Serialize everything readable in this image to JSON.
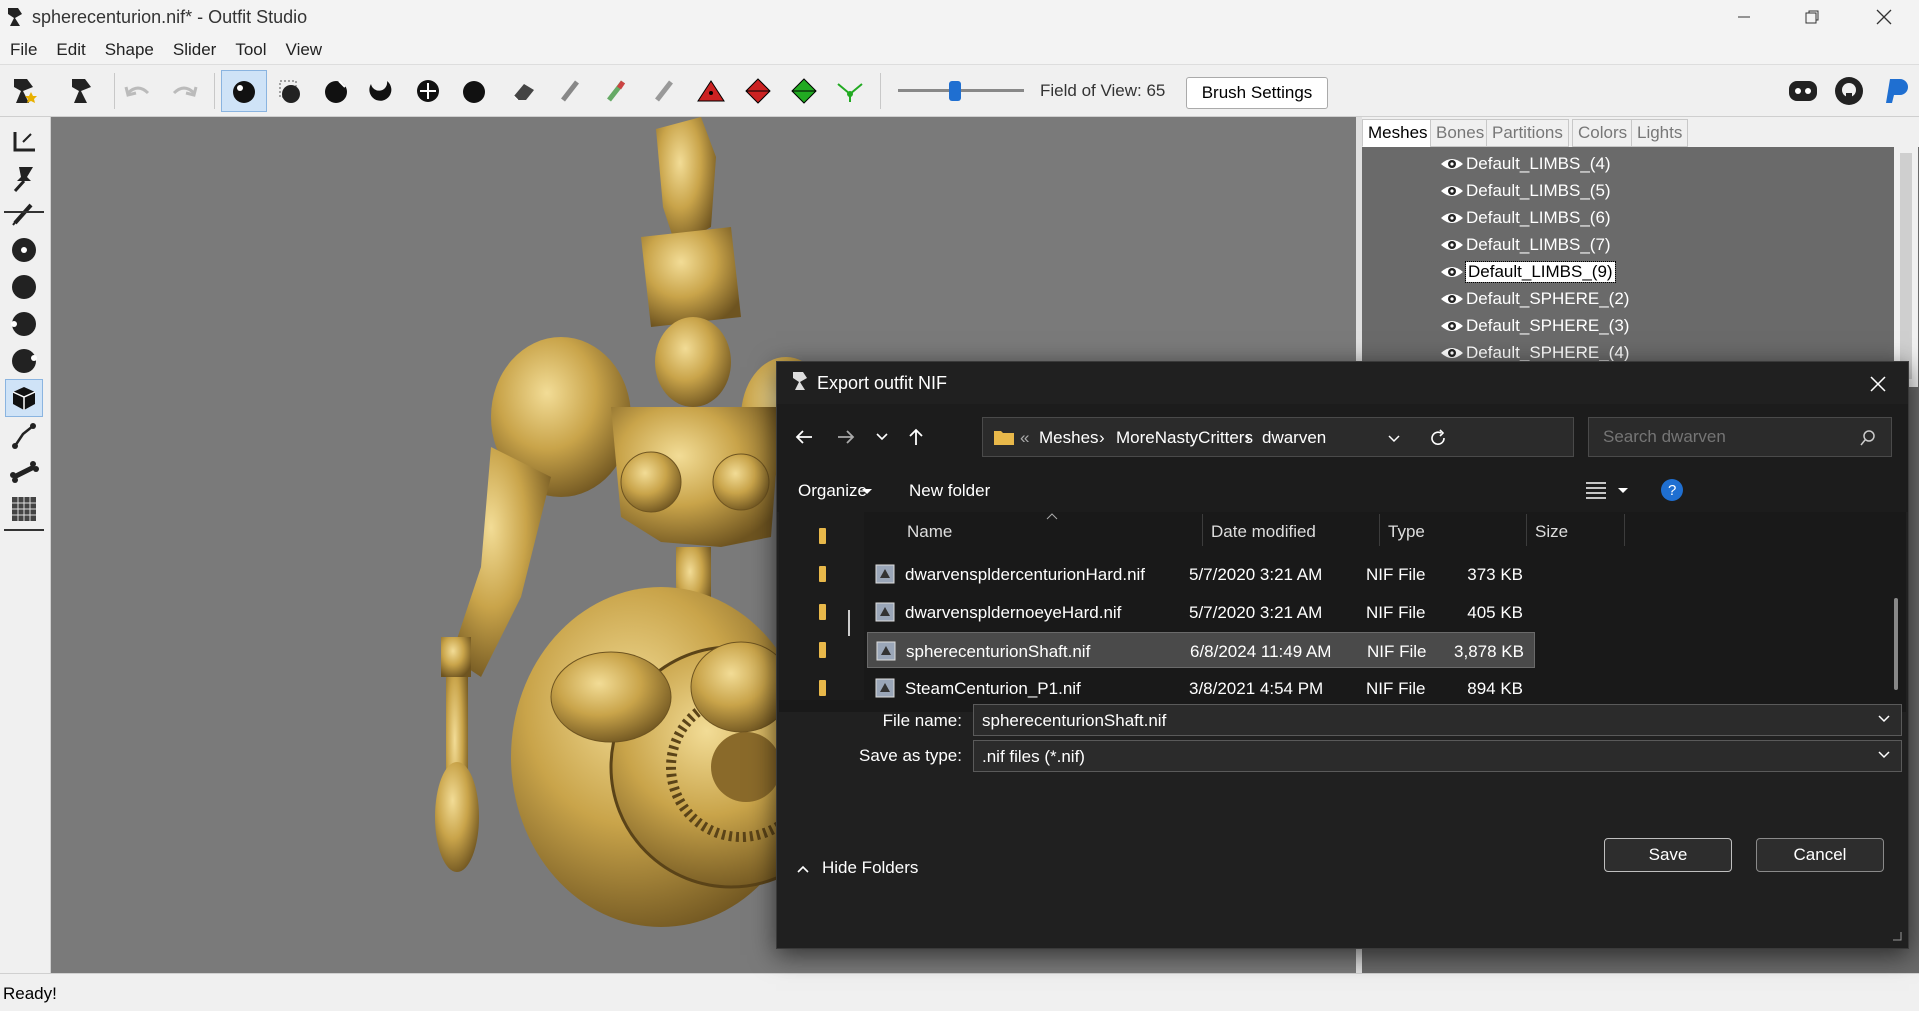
{
  "window": {
    "title": "spherecenturion.nif* - Outfit Studio"
  },
  "menu": [
    "File",
    "Edit",
    "Shape",
    "Slider",
    "Tool",
    "View"
  ],
  "toolbar": {
    "fov_label": "Field of View: 65",
    "brush_settings_label": "Brush Settings",
    "fov_slider_fraction": 0.45
  },
  "right_panel": {
    "tabs": [
      "Meshes",
      "Bones",
      "Partitions",
      "Colors",
      "Lights"
    ],
    "meshes": [
      "Default_LIMBS_(4)",
      "Default_LIMBS_(5)",
      "Default_LIMBS_(6)",
      "Default_LIMBS_(7)",
      "Default_LIMBS_(9)",
      "Default_SPHERE_(2)",
      "Default_SPHERE_(3)",
      "Default_SPHERE_(4)"
    ],
    "selected_mesh": "Default_LIMBS_(9)"
  },
  "status": {
    "text": "Ready!"
  },
  "dialog": {
    "title": "Export outfit NIF",
    "breadcrumb": {
      "overflow": "«",
      "parts": [
        "Meshes",
        "MoreNastyCritters",
        "dwarven"
      ]
    },
    "search_placeholder": "Search dwarven",
    "organize_label": "Organize",
    "new_folder_label": "New folder",
    "columns": {
      "name": "Name",
      "date": "Date modified",
      "type": "Type",
      "size": "Size"
    },
    "files": [
      {
        "name": "dwarvenspldercenturionHard.nif",
        "date": "5/7/2020 3:21 AM",
        "type": "NIF File",
        "size": "373 KB"
      },
      {
        "name": "dwarvenspldernoeyeHard.nif",
        "date": "5/7/2020 3:21 AM",
        "type": "NIF File",
        "size": "405 KB"
      },
      {
        "name": "spherecenturionShaft.nif",
        "date": "6/8/2024 11:49 AM",
        "type": "NIF File",
        "size": "3,878 KB"
      },
      {
        "name": "SteamCenturion_P1.nif",
        "date": "3/8/2021 4:54 PM",
        "type": "NIF File",
        "size": "894 KB"
      }
    ],
    "selected_file": "spherecenturionShaft.nif",
    "file_name_label": "File name:",
    "file_name_value": "spherecenturionShaft.nif",
    "save_type_label": "Save as type:",
    "save_type_value": ".nif files (*.nif)",
    "hide_folders_label": "Hide Folders",
    "save_label": "Save",
    "cancel_label": "Cancel"
  },
  "colors": {
    "accent": "#1f6fd1",
    "selection": "#cfe3f7",
    "folder": "#e8b84a",
    "gold_model": "#c9a44a"
  }
}
